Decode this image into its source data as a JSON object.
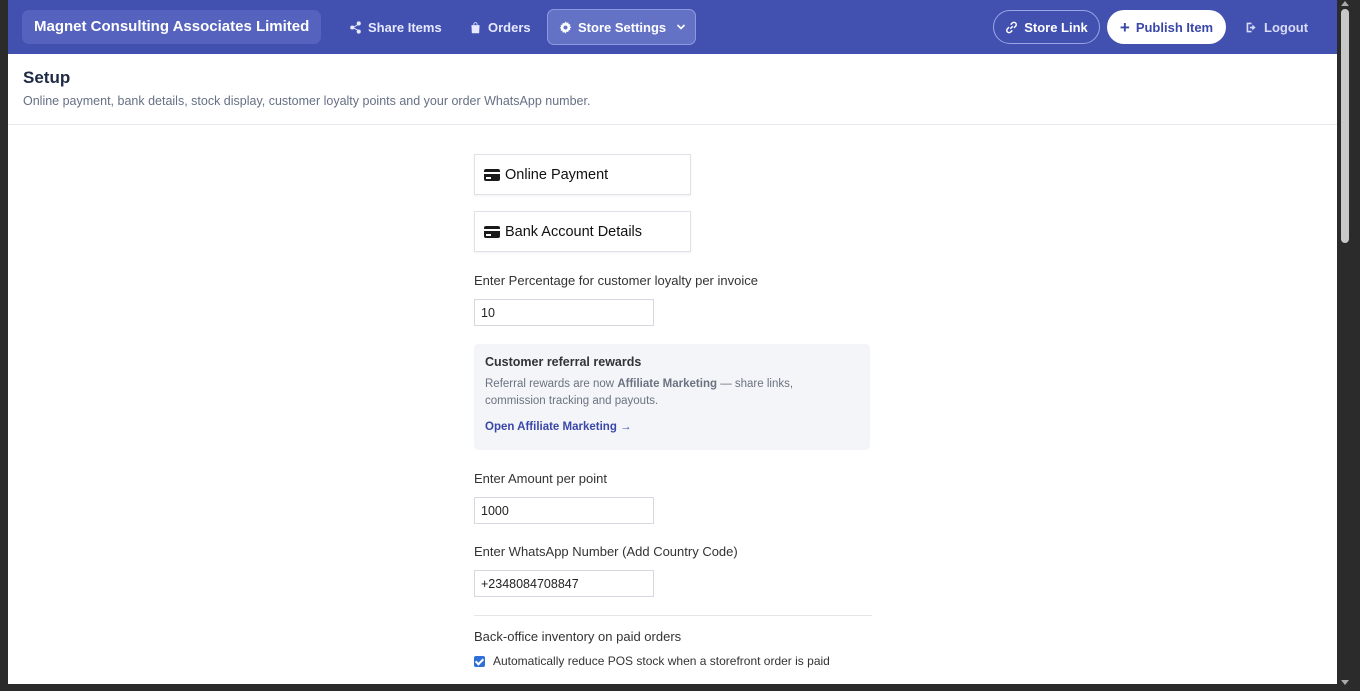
{
  "nav": {
    "brand": "Magnet Consulting Associates Limited",
    "share_items": "Share Items",
    "orders": "Orders",
    "store_settings": "Store Settings",
    "store_link": "Store Link",
    "publish_item": "Publish Item",
    "logout": "Logout"
  },
  "header": {
    "title": "Setup",
    "subtitle": "Online payment, bank details, stock display, customer loyalty points and your order WhatsApp number."
  },
  "sections": {
    "online_payment": "Online Payment",
    "bank_account": "Bank Account Details"
  },
  "loyalty": {
    "label": "Enter Percentage for customer loyalty per invoice",
    "value": "10"
  },
  "referral": {
    "title": "Customer referral rewards",
    "text_before": "Referral rewards are now ",
    "text_bold": "Affiliate Marketing",
    "text_after": " — share links, commission tracking and payouts.",
    "link": "Open Affiliate Marketing →"
  },
  "amount_per_point": {
    "label": "Enter Amount per point",
    "value": "1000"
  },
  "whatsapp": {
    "label": "Enter WhatsApp Number (Add Country Code)",
    "value": "+2348084708847"
  },
  "inventory": {
    "label": "Back-office inventory on paid orders",
    "checkbox_label": "Automatically reduce POS stock when a storefront order is paid",
    "checked": true
  },
  "icons": {
    "share": "share-icon",
    "orders": "bag-icon",
    "settings": "gear-icon",
    "link": "link-icon",
    "plus": "plus-icon",
    "logout": "logout-icon",
    "card": "credit-card-icon"
  },
  "colors": {
    "nav_bg": "#4250b0",
    "accent_link": "#3b47a8",
    "checkbox": "#2f6fd6"
  }
}
